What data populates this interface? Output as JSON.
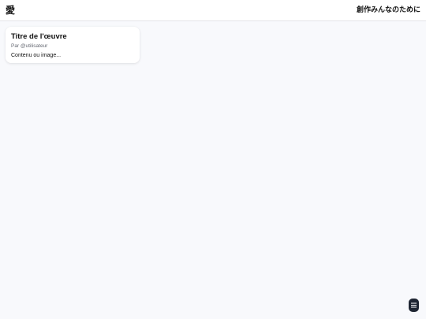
{
  "header": {
    "logo": "愛",
    "tagline": "創作みんなのために"
  },
  "card": {
    "title": "Titre de l'œuvre",
    "author": "Par @utilisateur",
    "content": "Contenu ou image..."
  },
  "menu_button": {
    "icon": "hamburger-menu-icon"
  },
  "colors": {
    "background": "#f8f9fc",
    "header_bg": "#ffffff",
    "card_bg": "#ffffff",
    "menu_button_bg": "#1f2633",
    "muted_text": "#666a73"
  }
}
